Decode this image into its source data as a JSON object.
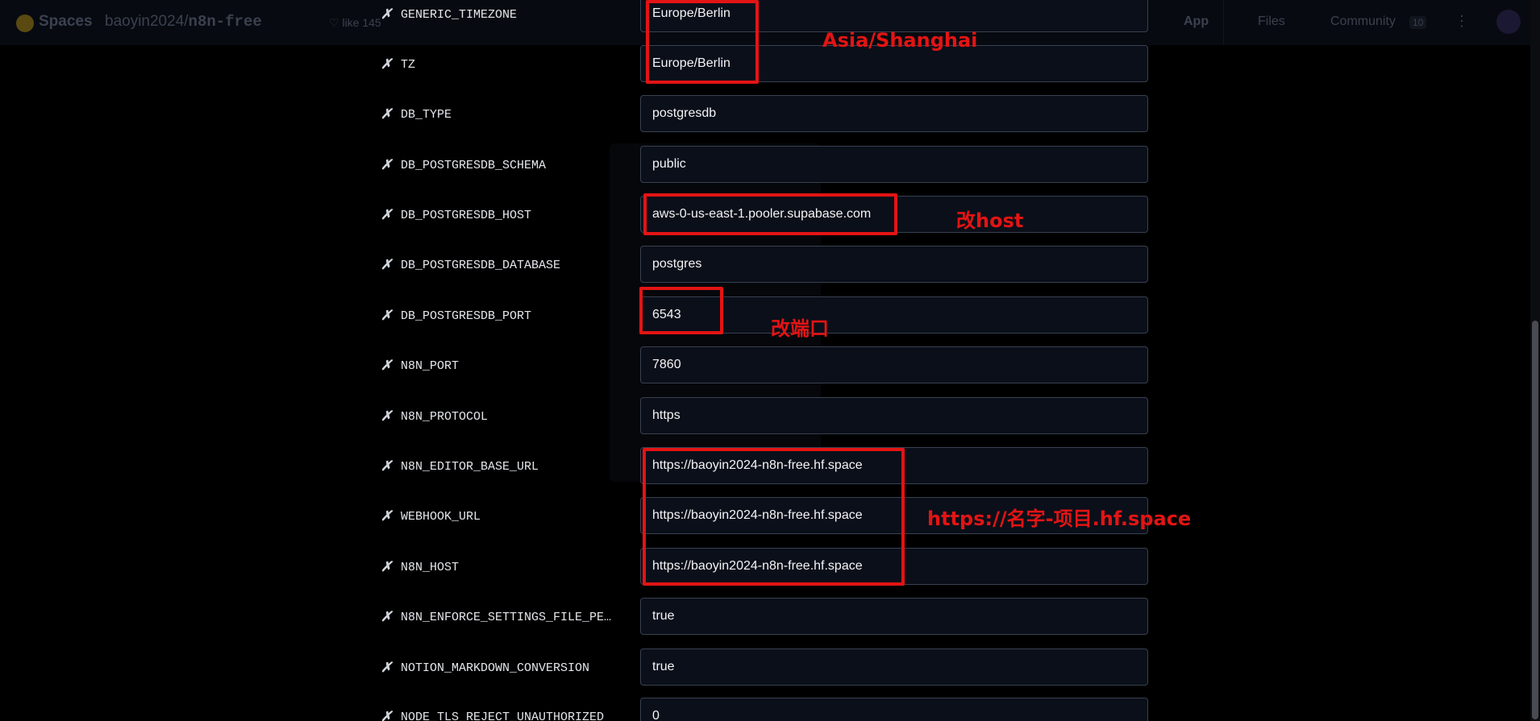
{
  "topbar": {
    "spaces": "Spaces",
    "owner": "baoyin2024",
    "repo": "n8n-free",
    "like_label": "like",
    "like_count": "145",
    "tabs": {
      "app": "App",
      "files": "Files",
      "community": "Community"
    },
    "community_count": "10"
  },
  "env_vars": [
    {
      "name": "GENERIC_TIMEZONE",
      "value": "Europe/Berlin"
    },
    {
      "name": "TZ",
      "value": "Europe/Berlin"
    },
    {
      "name": "DB_TYPE",
      "value": "postgresdb"
    },
    {
      "name": "DB_POSTGRESDB_SCHEMA",
      "value": "public"
    },
    {
      "name": "DB_POSTGRESDB_HOST",
      "value": "aws-0-us-east-1.pooler.supabase.com"
    },
    {
      "name": "DB_POSTGRESDB_DATABASE",
      "value": "postgres"
    },
    {
      "name": "DB_POSTGRESDB_PORT",
      "value": "6543"
    },
    {
      "name": "N8N_PORT",
      "value": "7860"
    },
    {
      "name": "N8N_PROTOCOL",
      "value": "https"
    },
    {
      "name": "N8N_EDITOR_BASE_URL",
      "value": "https://baoyin2024-n8n-free.hf.space"
    },
    {
      "name": "WEBHOOK_URL",
      "value": "https://baoyin2024-n8n-free.hf.space"
    },
    {
      "name": "N8N_HOST",
      "value": "https://baoyin2024-n8n-free.hf.space"
    },
    {
      "name": "N8N_ENFORCE_SETTINGS_FILE_PE…",
      "value": "true"
    },
    {
      "name": "NOTION_MARKDOWN_CONVERSION",
      "value": "true"
    },
    {
      "name": "NODE_TLS_REJECT_UNAUTHORIZED",
      "value": "0"
    }
  ],
  "delete_glyph": "✗",
  "annotations": {
    "timezone": "Asia/Shanghai",
    "host": "改host",
    "port": "改端口",
    "url": "https://名字-项目.hf.space"
  },
  "colors": {
    "annotation": "#e31414",
    "background": "#000000",
    "input_bg": "#0b0f19",
    "input_border": "#374151"
  }
}
